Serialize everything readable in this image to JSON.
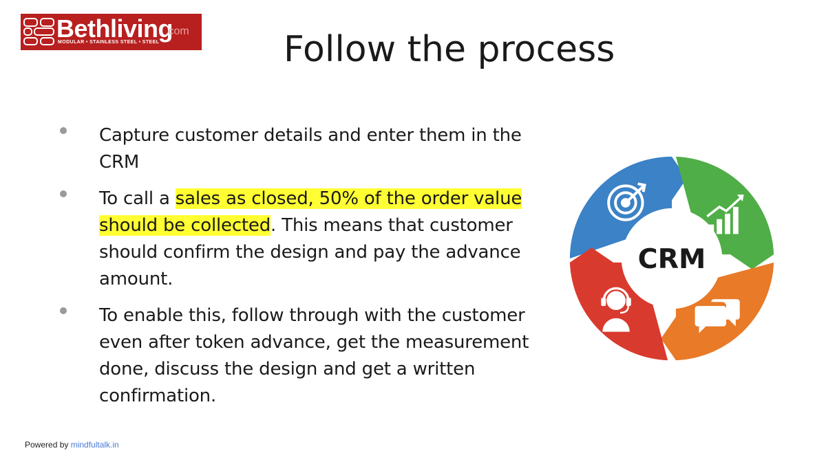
{
  "logo": {
    "name": "Bethliving",
    "suffix": ".com",
    "tagline": "MODULAR • STAINLESS STEEL • STEEL"
  },
  "title": "Follow the process",
  "bullets": [
    {
      "text": "Capture customer details and enter them in the CRM"
    },
    {
      "before": "To call a ",
      "highlight": "sales as closed, 50% of the order value should be collected",
      "after": ". This means that customer should confirm the design and pay the advance amount."
    },
    {
      "text": "To enable this, follow through with the customer even after token advance, get the measurement done, discuss the design and get a written confirmation."
    }
  ],
  "diagram": {
    "center_label": "CRM",
    "segments": [
      {
        "icon": "target-icon",
        "color": "#3b82c6"
      },
      {
        "icon": "growth-chart-icon",
        "color": "#4fae47"
      },
      {
        "icon": "chat-bubbles-icon",
        "color": "#e87a28"
      },
      {
        "icon": "headset-agent-icon",
        "color": "#d93a2e"
      }
    ]
  },
  "footer": {
    "prefix": "Powered by ",
    "link": "mindfultalk.in"
  },
  "colors": {
    "highlight": "#ffff33",
    "logo_bg": "#b81f1f",
    "footer_link": "#4a7ad6"
  }
}
